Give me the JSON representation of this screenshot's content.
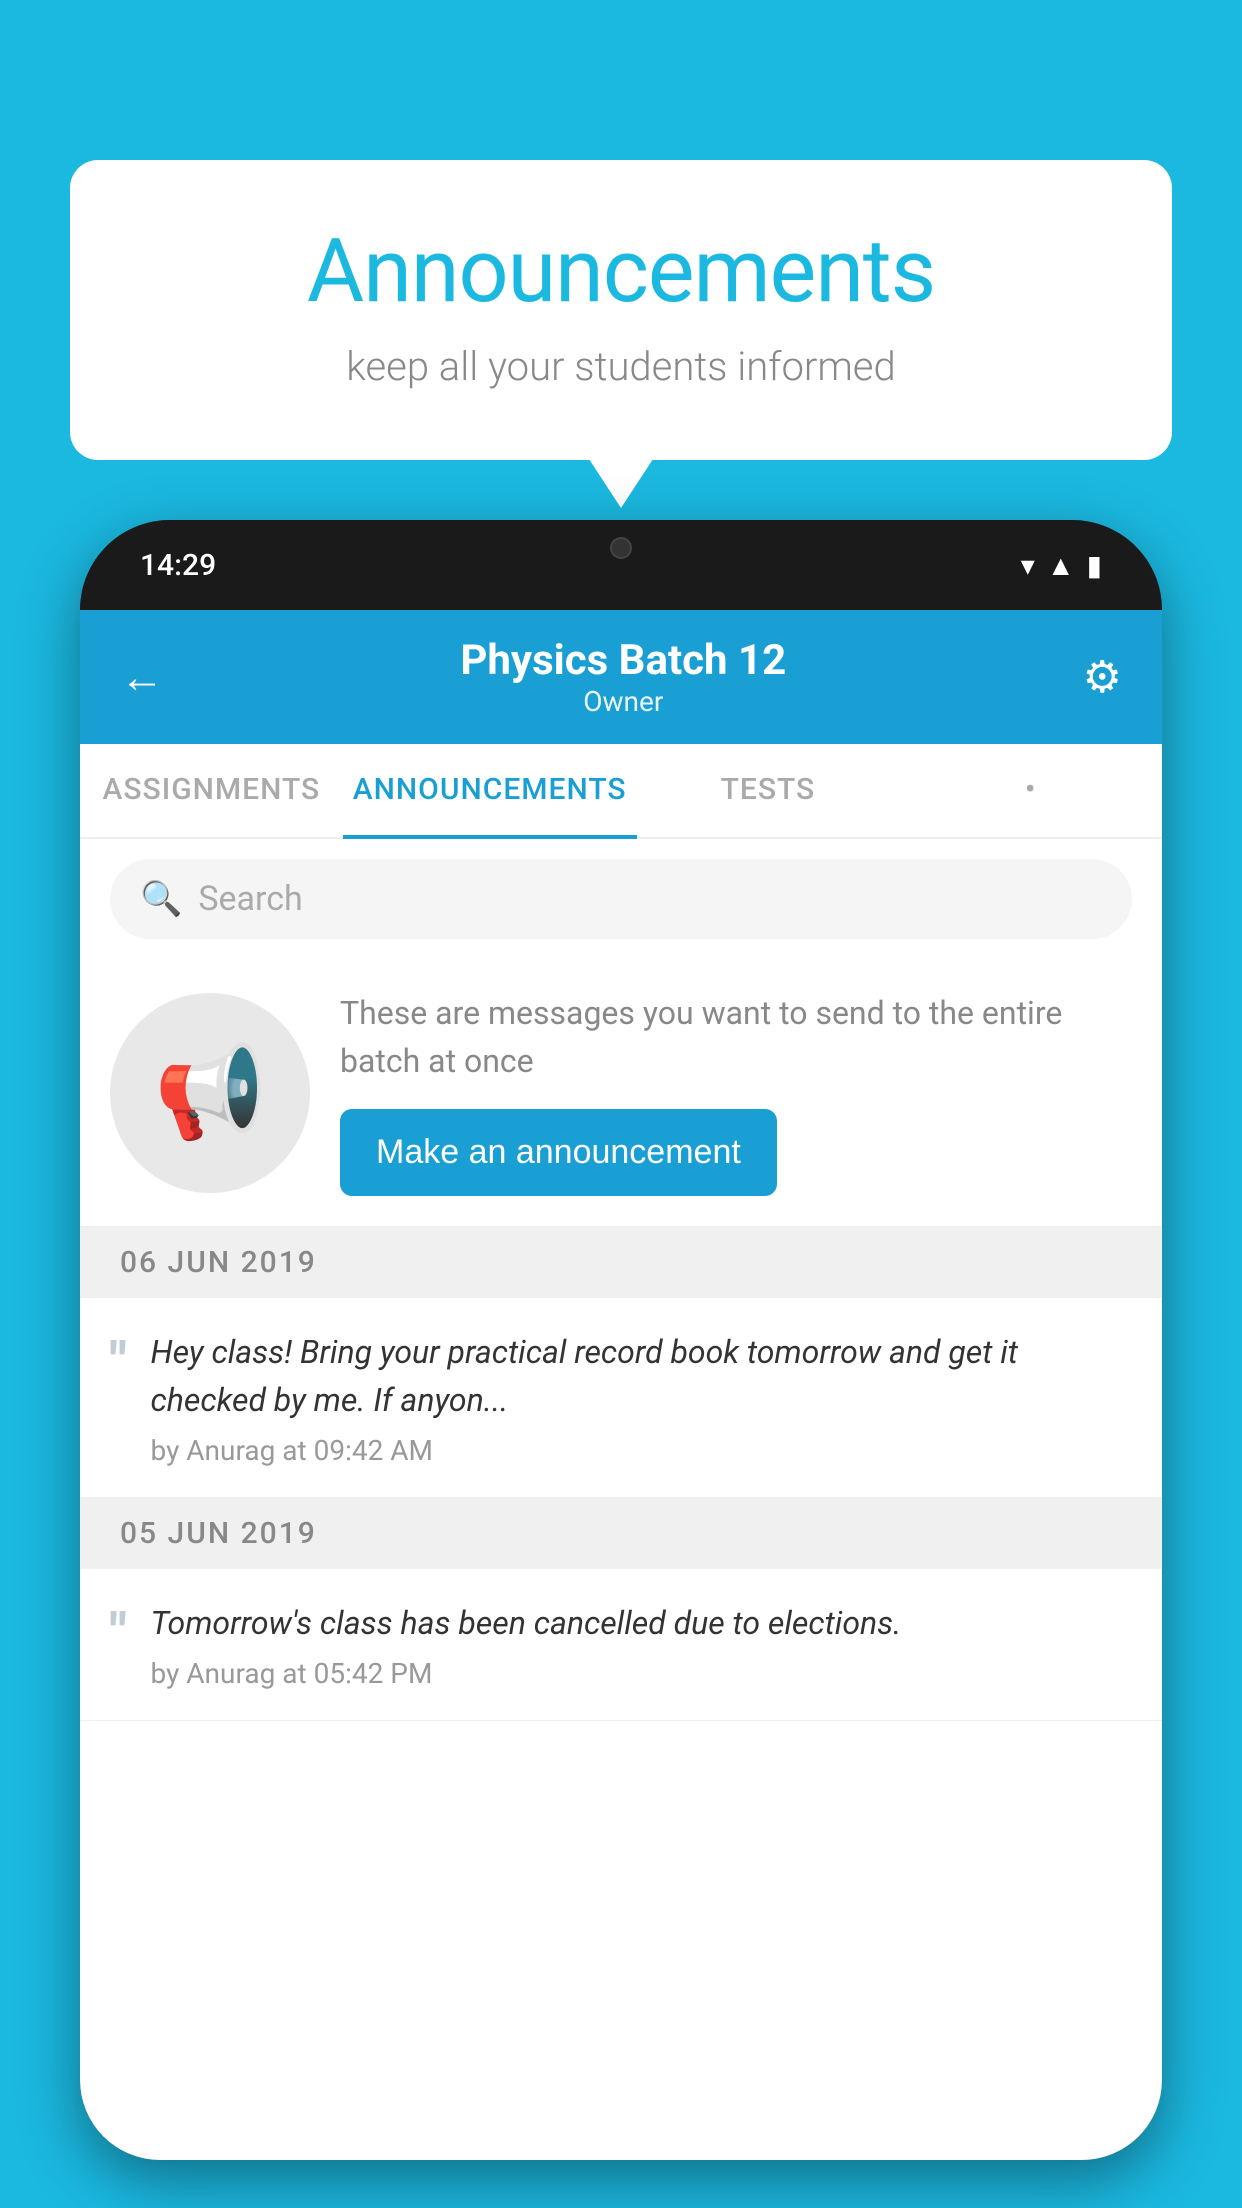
{
  "background_color": "#1bb8e0",
  "speech_bubble": {
    "title": "Announcements",
    "subtitle": "keep all your students informed"
  },
  "phone": {
    "status_bar": {
      "time": "14:29"
    },
    "header": {
      "back_label": "←",
      "title": "Physics Batch 12",
      "subtitle": "Owner",
      "settings_label": "⚙"
    },
    "tabs": [
      {
        "label": "ASSIGNMENTS",
        "active": false
      },
      {
        "label": "ANNOUNCEMENTS",
        "active": true
      },
      {
        "label": "TESTS",
        "active": false
      },
      {
        "label": "•",
        "active": false
      }
    ],
    "search": {
      "placeholder": "Search"
    },
    "empty_state": {
      "description": "These are messages you want to send to the entire batch at once",
      "button_label": "Make an announcement"
    },
    "announcements": [
      {
        "date": "06  JUN  2019",
        "message": "Hey class! Bring your practical record book tomorrow and get it checked by me. If anyon...",
        "meta": "by Anurag at 09:42 AM"
      },
      {
        "date": "05  JUN  2019",
        "message": "Tomorrow's class has been cancelled due to elections.",
        "meta": "by Anurag at 05:42 PM"
      }
    ]
  }
}
